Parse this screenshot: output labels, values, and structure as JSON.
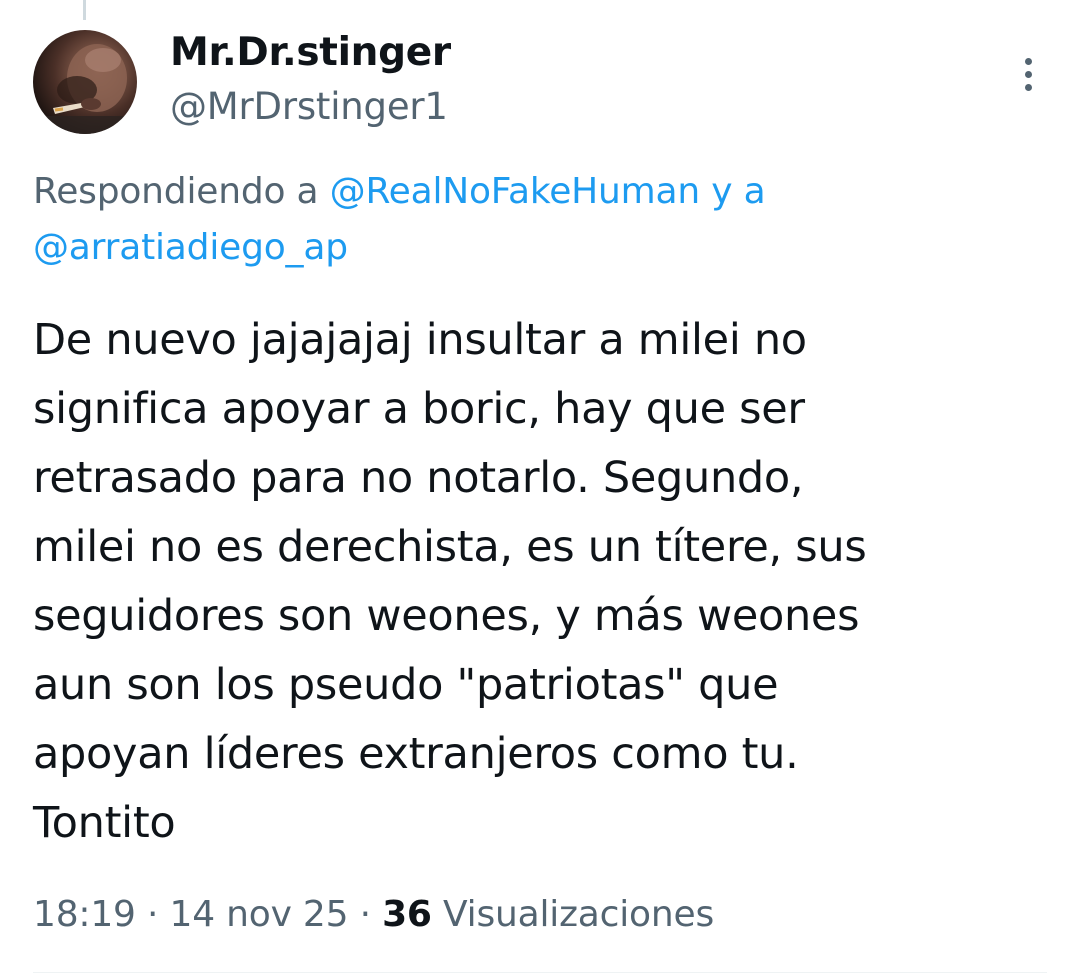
{
  "user": {
    "display_name": "Mr.Dr.stinger",
    "handle": "@MrDrstinger1"
  },
  "reply": {
    "prefix": "Respondiendo a ",
    "mentions": [
      "@RealNoFakeHuman",
      "@arratiadiego_ap"
    ],
    "conjunction": " y a"
  },
  "tweet": {
    "text": "De nuevo jajajajaj insultar a milei no\nsignifica apoyar a boric, hay que ser\nretrasado para no notarlo. Segundo,\nmilei no es derechista, es un títere, sus\nseguidores son weones, y más weones\naun son los pseudo \"patriotas\" que\napoyan líderes extranjeros como tu.\nTontito"
  },
  "meta": {
    "time": "18:19",
    "separator": " · ",
    "date": "14 nov 25",
    "views_count": "36",
    "views_label": " Visualizaciones"
  },
  "icons": {
    "more": "more-vertical-icon",
    "avatar": "avatar"
  },
  "colors": {
    "link": "#1d9bf0",
    "secondary": "#536471",
    "primary": "#0f1419",
    "divider": "#eff3f4"
  }
}
